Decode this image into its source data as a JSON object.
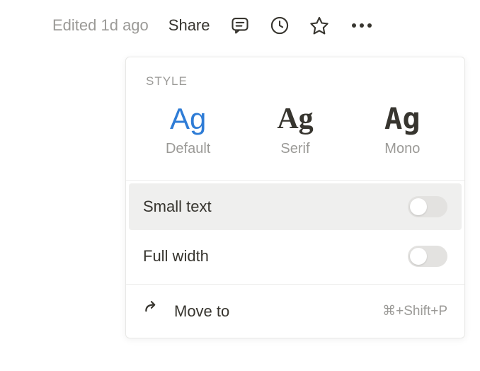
{
  "topbar": {
    "edited": "Edited 1d ago",
    "share": "Share"
  },
  "dropdown": {
    "style_label": "STYLE",
    "styles": [
      {
        "sample": "Ag",
        "label": "Default",
        "selected": true
      },
      {
        "sample": "Ag",
        "label": "Serif",
        "selected": false
      },
      {
        "sample": "Ag",
        "label": "Mono",
        "selected": false
      }
    ],
    "toggles": {
      "small_text": {
        "label": "Small text",
        "on": false
      },
      "full_width": {
        "label": "Full width",
        "on": false
      }
    },
    "actions": {
      "move_to": {
        "label": "Move to",
        "shortcut": "⌘+Shift+P"
      }
    }
  }
}
